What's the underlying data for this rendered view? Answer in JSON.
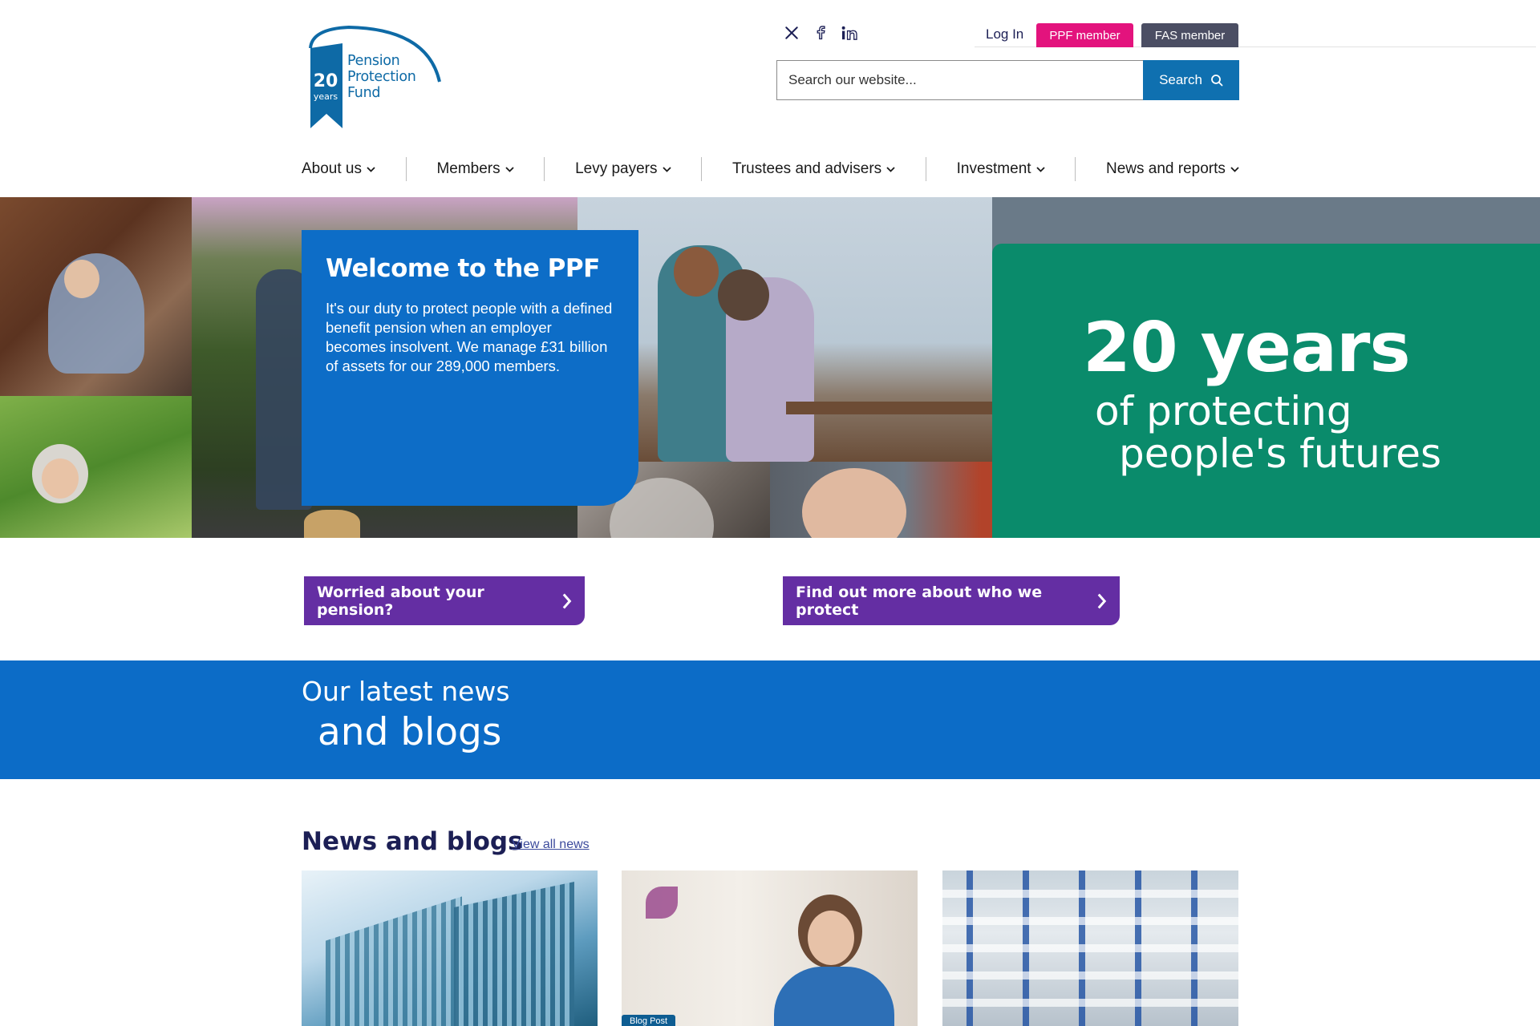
{
  "logo": {
    "name_lines": [
      "Pension",
      "Protection",
      "Fund"
    ],
    "anniversary_number": "20",
    "anniversary_unit": "years"
  },
  "social": {
    "icons": [
      "x-twitter-icon",
      "facebook-icon",
      "linkedin-icon"
    ]
  },
  "utility": {
    "login_label": "Log In",
    "ppf_member_label": "PPF member",
    "fas_member_label": "FAS member"
  },
  "search": {
    "placeholder": "Search our website...",
    "button_label": "Search"
  },
  "nav": {
    "items": [
      {
        "label": "About us"
      },
      {
        "label": "Members"
      },
      {
        "label": "Levy payers"
      },
      {
        "label": "Trustees and advisers"
      },
      {
        "label": "Investment"
      },
      {
        "label": "News and reports"
      }
    ]
  },
  "hero": {
    "title": "Welcome to the PPF",
    "body": "It's our duty to protect people with a defined benefit pension when an employer becomes insolvent. We manage £31 billion of assets for our 289,000 members.",
    "promo": {
      "line1": "20 years",
      "line2": "of protecting",
      "line3": "people's futures"
    }
  },
  "cta": {
    "worried_label": "Worried about your pension?",
    "who_we_protect_label": "Find out more about who we protect"
  },
  "latest": {
    "line1": "Our latest news",
    "line2": "and blogs"
  },
  "news": {
    "title": "News and blogs",
    "view_all_label": "View all news",
    "cards": [
      {
        "tag": ""
      },
      {
        "tag": "Blog Post"
      },
      {
        "tag": ""
      }
    ]
  },
  "colors": {
    "brand_blue": "#0d6dc7",
    "search_blue": "#0f70b0",
    "ppf_pink": "#e3137d",
    "fas_grey": "#4b4e63",
    "cta_purple": "#642ea3",
    "promo_green": "#0a8b6b",
    "navy_text": "#1c1f55"
  }
}
